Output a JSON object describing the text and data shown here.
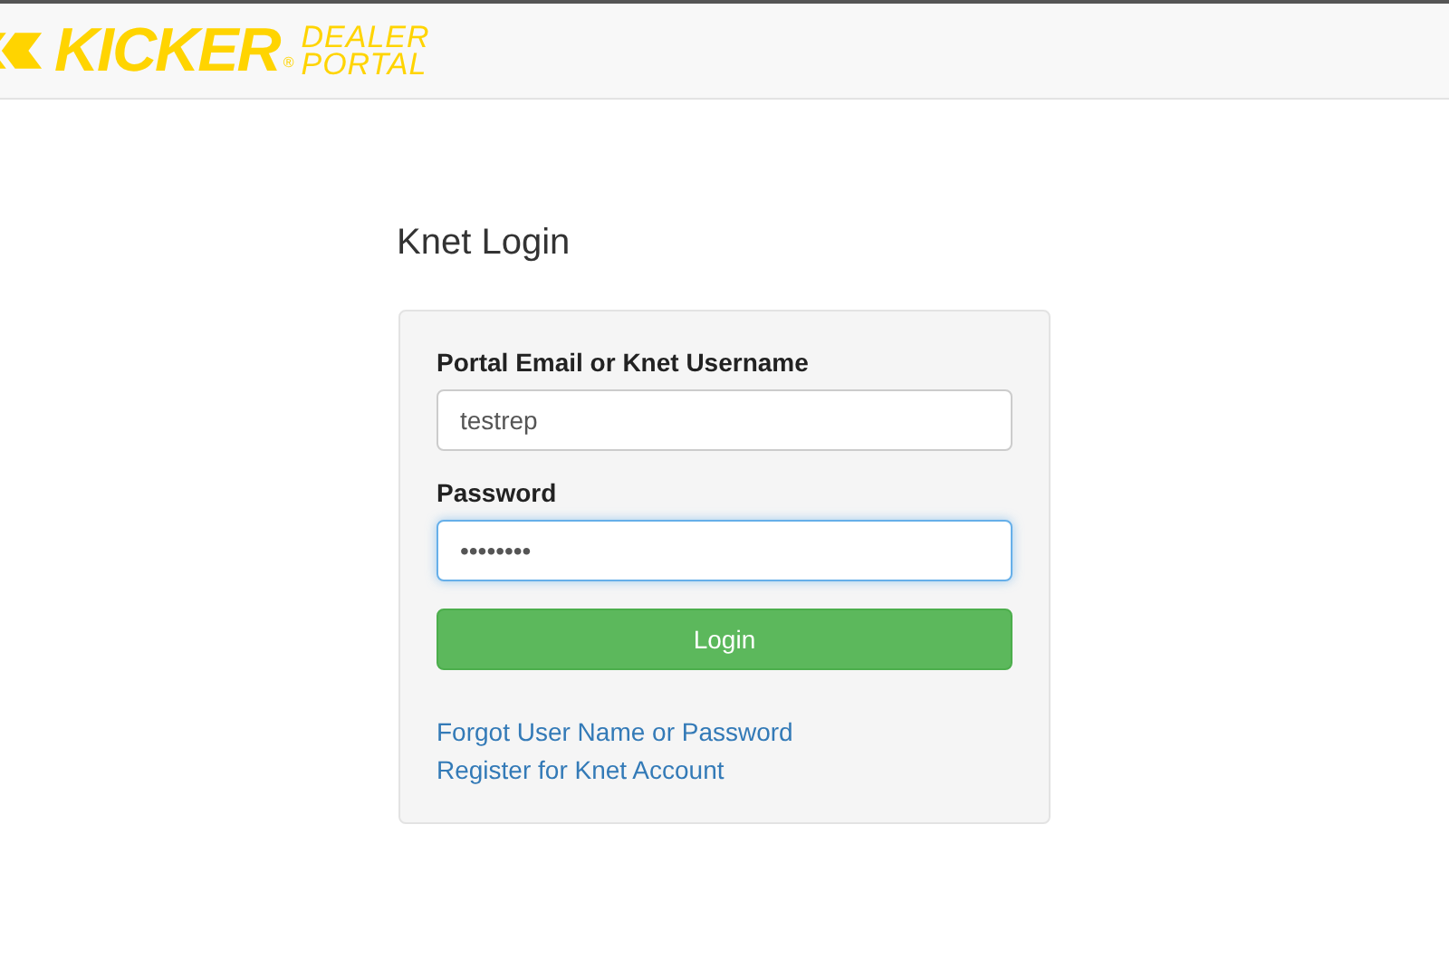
{
  "header": {
    "logo": {
      "brand": "KICKER",
      "registered": "®",
      "line_1": "DEALER",
      "line_2": "PORTAL"
    }
  },
  "title": "Knet Login",
  "form": {
    "fields": [
      {
        "label": "Portal Email or Knet Username",
        "value": "testrep",
        "focused": false
      },
      {
        "label": "Password",
        "value": "••••••••",
        "focused": true
      }
    ],
    "button": "Login",
    "links": [
      "Forgot User Name or Password",
      "Register for Knet Account"
    ]
  }
}
